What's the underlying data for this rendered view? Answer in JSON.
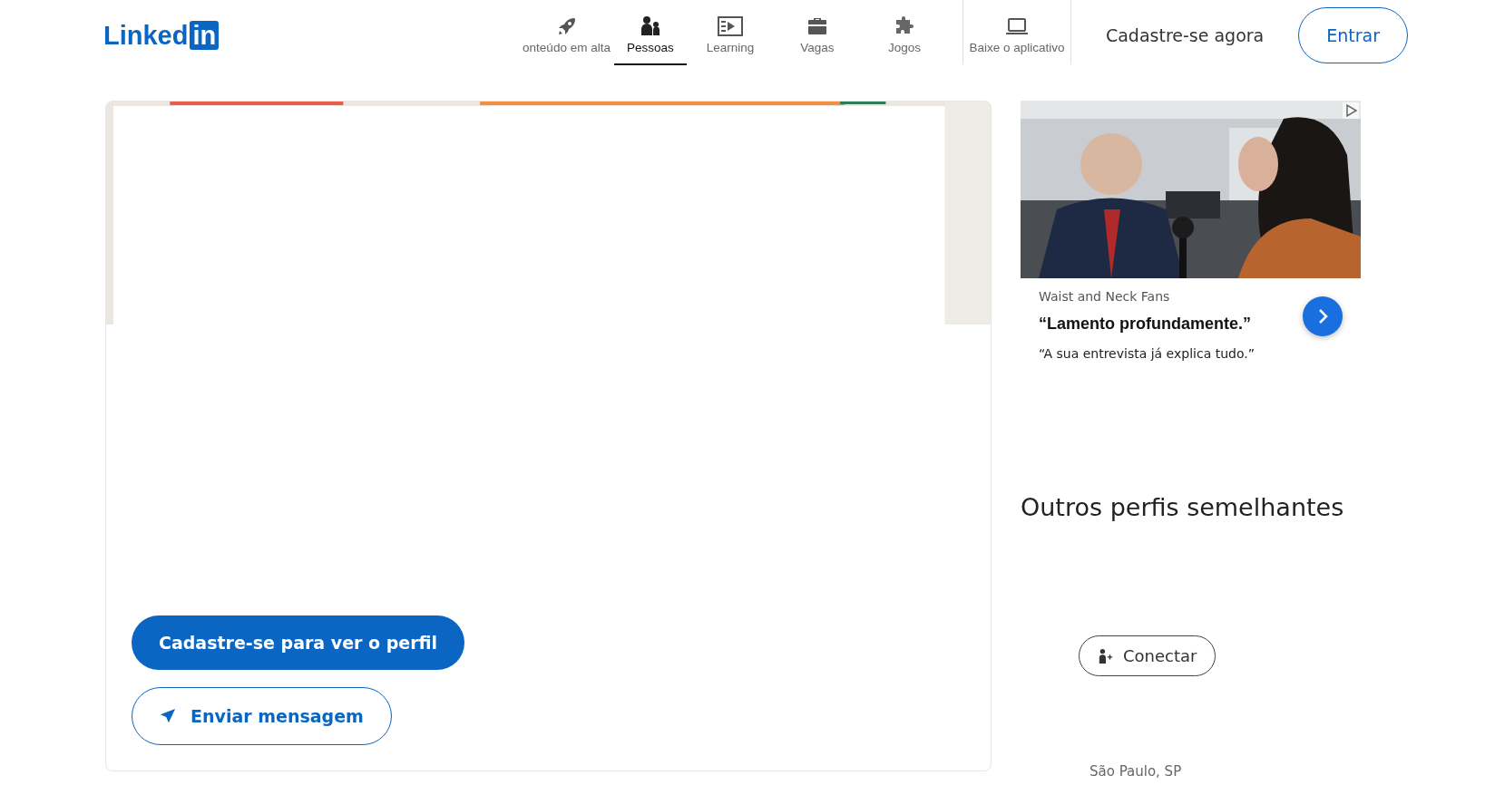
{
  "header": {
    "logo": {
      "word": "Linked",
      "badge": "in"
    },
    "nav": [
      {
        "label": "onteúdo em alta",
        "selected": false
      },
      {
        "label": "Pessoas",
        "selected": true
      },
      {
        "label": "Learning",
        "selected": false
      },
      {
        "label": "Vagas",
        "selected": false
      },
      {
        "label": "Jogos",
        "selected": false
      },
      {
        "label": "Baixe o aplicativo",
        "selected": false
      }
    ],
    "join_link": "Cadastre-se agora",
    "sign_in": "Entrar"
  },
  "profile": {
    "primary_button": "Cadastre-se para ver o perfil",
    "message_button": "Enviar mensagem"
  },
  "ad": {
    "advertiser": "Waist and Neck Fans",
    "headline": "“Lamento profundamente.”",
    "body": "“A sua entrevista já explica tudo.”"
  },
  "similar": {
    "title": "Outros perfis semelhantes",
    "connect_button": "Conectar",
    "location": "São Paulo, SP"
  }
}
